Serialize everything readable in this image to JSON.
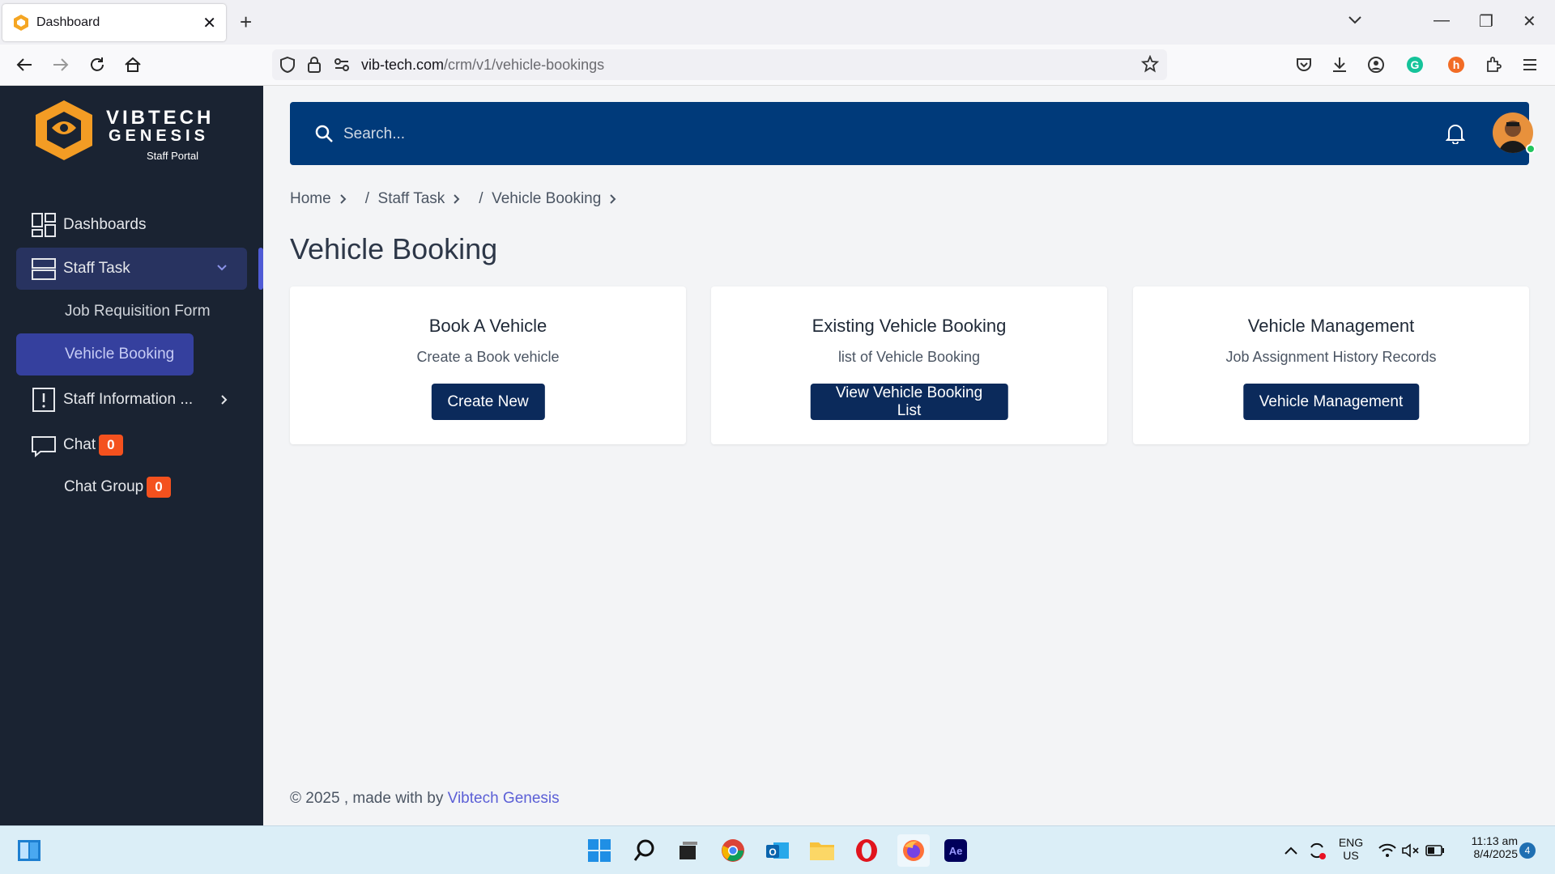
{
  "browser": {
    "tab_title": "Dashboard",
    "url_domain": "vib-tech.com",
    "url_path": "/crm/v1/vehicle-bookings"
  },
  "logo": {
    "line1": "VIBTECH",
    "line2": "GENESIS",
    "subtitle": "Staff Portal"
  },
  "sidebar": {
    "items": [
      {
        "label": "Dashboards"
      },
      {
        "label": "Staff Task"
      },
      {
        "label": "Job Requisition Form"
      },
      {
        "label": "Vehicle Booking"
      },
      {
        "label": "Staff Information ..."
      },
      {
        "label": "Chat",
        "badge": "0"
      },
      {
        "label": "Chat Group",
        "badge": "0"
      }
    ]
  },
  "search": {
    "placeholder": "Search..."
  },
  "breadcrumb": [
    "Home",
    "/  Staff Task",
    "/  Vehicle Booking"
  ],
  "page_title": "Vehicle Booking",
  "cards": [
    {
      "title": "Book A Vehicle",
      "desc": "Create a Book vehicle",
      "button": "Create New"
    },
    {
      "title": "Existing Vehicle Booking",
      "desc": "list of Vehicle Booking",
      "button": "View Vehicle Booking List"
    },
    {
      "title": "Vehicle Management",
      "desc": "Job Assignment History Records",
      "button": "Vehicle Management"
    }
  ],
  "footer": {
    "text": "© 2025 , made with by ",
    "link": "Vibtech Genesis"
  },
  "taskbar": {
    "lang1": "ENG",
    "lang2": "US",
    "time": "11:13 am",
    "date": "8/4/2025",
    "notif_count": "4"
  },
  "colors": {
    "sidebar_bg": "#1a2332",
    "topbar_bg": "#003a7a",
    "button_bg": "#0b2a5b",
    "badge_bg": "#f4511e",
    "active_sub_bg": "#35409e"
  }
}
